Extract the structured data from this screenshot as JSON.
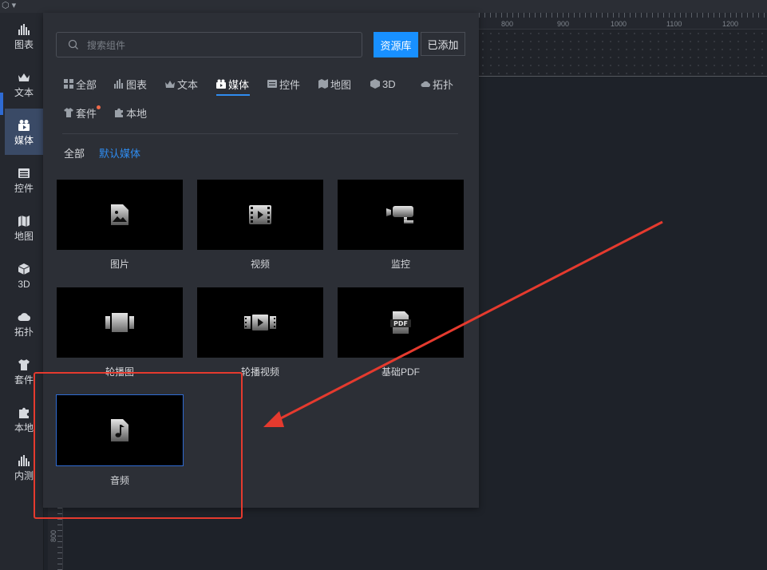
{
  "topbar": {
    "text": "⬡ ▾"
  },
  "leftnav": {
    "items": [
      {
        "label": "图表",
        "icon": "bar-chart-icon"
      },
      {
        "label": "文本",
        "icon": "crown-text-icon"
      },
      {
        "label": "媒体",
        "icon": "media-camera-icon",
        "active": true
      },
      {
        "label": "控件",
        "icon": "controls-icon"
      },
      {
        "label": "地图",
        "icon": "map-icon"
      },
      {
        "label": "3D",
        "icon": "cube-icon"
      },
      {
        "label": "拓扑",
        "icon": "cloud-topology-icon"
      },
      {
        "label": "套件",
        "icon": "shirt-kit-icon"
      },
      {
        "label": "本地",
        "icon": "puzzle-icon"
      },
      {
        "label": "内测",
        "icon": "beta-chart-icon"
      }
    ]
  },
  "ruler": {
    "labels": [
      "800",
      "900",
      "1000",
      "1100",
      "1200"
    ],
    "left_label": "800"
  },
  "panel": {
    "search_placeholder": "搜索组件",
    "library_button": "资源库",
    "added_button": "已添加",
    "category_tabs": [
      {
        "label": "全部",
        "icon": "grid-icon"
      },
      {
        "label": "图表",
        "icon": "bar-chart-icon"
      },
      {
        "label": "文本",
        "icon": "crown-text-icon"
      },
      {
        "label": "媒体",
        "icon": "media-camera-icon",
        "active": true
      },
      {
        "label": "控件",
        "icon": "controls-icon"
      },
      {
        "label": "地图",
        "icon": "map-icon"
      },
      {
        "label": "3D",
        "icon": "cube-icon"
      },
      {
        "label": "拓扑",
        "icon": "cloud-topology-icon"
      },
      {
        "label": "套件",
        "icon": "shirt-kit-icon"
      },
      {
        "label": "本地",
        "icon": "puzzle-icon"
      }
    ],
    "sub_tabs": [
      {
        "label": "全部"
      },
      {
        "label": "默认媒体",
        "active": true
      }
    ],
    "cards": [
      {
        "label": "图片",
        "icon": "image-file-icon"
      },
      {
        "label": "视频",
        "icon": "video-film-icon"
      },
      {
        "label": "监控",
        "icon": "surveillance-camera-icon"
      },
      {
        "label": "轮播图",
        "icon": "carousel-icon"
      },
      {
        "label": "轮播视频",
        "icon": "video-carousel-icon"
      },
      {
        "label": "基础PDF",
        "icon": "pdf-icon"
      },
      {
        "label": "音频",
        "icon": "audio-file-icon",
        "selected": true
      }
    ]
  },
  "colors": {
    "accent": "#1890ff",
    "annotation": "#e53a2e",
    "active_nav": "#3a4a66"
  }
}
